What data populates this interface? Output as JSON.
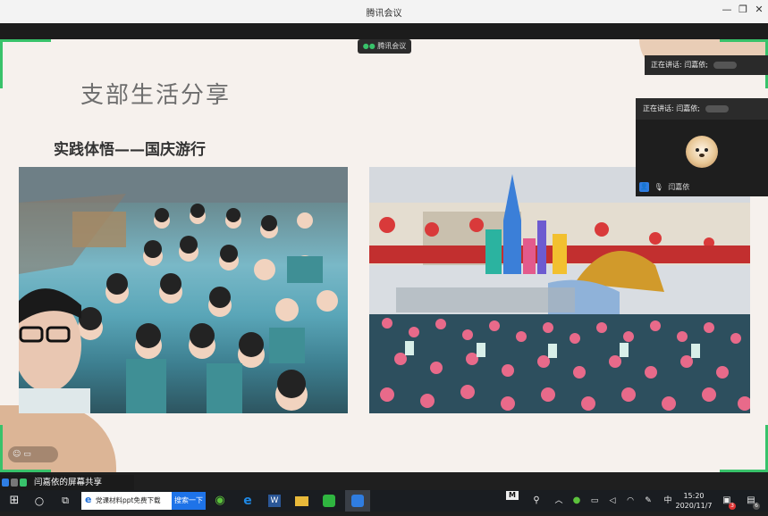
{
  "window": {
    "title": "腾讯会议",
    "minimize": "—",
    "restore": "❐",
    "close": "✕"
  },
  "meeting_badge": {
    "icon": "●●",
    "label": "腾讯会议"
  },
  "speaking": {
    "top_label": "正在讲话: 闫嘉依;",
    "panel_label": "正在讲话: 闫嘉依;",
    "participant_name": "闫嘉依"
  },
  "slide": {
    "title": "支部生活分享",
    "subtitle": "实践体悟——国庆游行"
  },
  "reaction_bar": {
    "icons": "☺ ▭"
  },
  "share_status": {
    "text": "闫嘉依的屏幕共享"
  },
  "taskbar": {
    "ie_tab_text": "党课材料ppt免费下载",
    "search_button": "搜索一下",
    "input_method": "中",
    "time": "15:20",
    "date": "2020/11/7",
    "notification_count": "6",
    "tray_badge": "3",
    "m_label": "M"
  },
  "colors": {
    "accent_green": "#38c26a",
    "slide_bg": "#f6f1ed",
    "search_blue": "#1e73e8"
  }
}
